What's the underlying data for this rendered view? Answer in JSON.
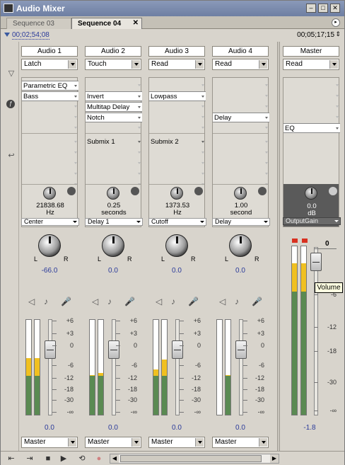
{
  "window": {
    "title": "Audio Mixer"
  },
  "tabs": [
    {
      "label": "Sequence 03"
    },
    {
      "label": "Sequence 04"
    }
  ],
  "timecode": {
    "current": "00;02;54;08",
    "duration": "00;05;17;15"
  },
  "tracks": [
    {
      "name": "Audio 1",
      "automation": "Latch",
      "effects": [
        "Parametric EQ",
        "Bass",
        "",
        "",
        ""
      ],
      "sends": [
        "",
        "",
        "",
        "",
        ""
      ],
      "knob_value": "21838.68",
      "knob_unit": "Hz",
      "param": "Center",
      "pan": "-66.0",
      "volume": "0.0",
      "output": "Master",
      "meter_left": 0.6,
      "meter_right": 0.6,
      "fader_pos": 0.0
    },
    {
      "name": "Audio 2",
      "automation": "Touch",
      "effects": [
        "",
        "Invert",
        "Multitap Delay",
        "Notch",
        ""
      ],
      "sends": [
        "Submix 1",
        "",
        "",
        "",
        ""
      ],
      "knob_value": "0.25",
      "knob_unit": "seconds",
      "param": "Delay 1",
      "pan": "0.0",
      "volume": "0.0",
      "output": "Master",
      "meter_left": 0.42,
      "meter_right": 0.44,
      "fader_pos": 0.0
    },
    {
      "name": "Audio 3",
      "automation": "Read",
      "effects": [
        "",
        "Lowpass",
        "",
        "",
        ""
      ],
      "sends": [
        "Submix 2",
        "",
        "",
        "",
        ""
      ],
      "knob_value": "1373.53",
      "knob_unit": "Hz",
      "param": "Cutoff",
      "pan": "0.0",
      "volume": "0.0",
      "output": "Master",
      "meter_left": 0.48,
      "meter_right": 0.58,
      "fader_pos": 0.0
    },
    {
      "name": "Audio 4",
      "automation": "Read",
      "effects": [
        "",
        "",
        "",
        "Delay",
        ""
      ],
      "sends": [
        "",
        "",
        "",
        "",
        ""
      ],
      "knob_value": "1.00",
      "knob_unit": "second",
      "param": "Delay",
      "pan": "0.0",
      "volume": "0.0",
      "output": "Master",
      "meter_left": 0.0,
      "meter_right": 0.42,
      "fader_pos": 0.0
    }
  ],
  "master": {
    "name": "Master",
    "automation": "Read",
    "effect": "EQ",
    "knob_value": "0.0",
    "knob_unit": "dB",
    "param": "OutputGain",
    "volume": "-1.8",
    "zero_label": "0",
    "meter_left": 0.9,
    "meter_right": 0.9
  },
  "scale": [
    "+6",
    "+3",
    "0",
    "-6",
    "-12",
    "-18",
    "-30",
    "-∞"
  ],
  "master_scale": [
    "-6",
    "-12",
    "-18",
    "-30",
    "-∞"
  ],
  "tooltip": "Volume",
  "colors": {
    "meter_green": "#5a8a52",
    "meter_yellow": "#f0c020",
    "clip_red": "#d83020",
    "link_blue": "#2a3a9a"
  }
}
